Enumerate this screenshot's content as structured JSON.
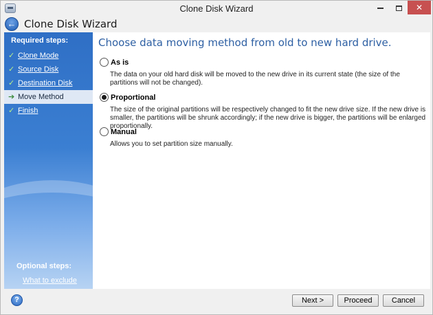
{
  "window": {
    "title": "Clone Disk Wizard"
  },
  "header": {
    "title": "Clone Disk Wizard",
    "back_icon": "back-arrow-icon"
  },
  "sidebar": {
    "required_heading": "Required steps:",
    "steps": [
      {
        "label": "Clone Mode",
        "completed": true,
        "current": false
      },
      {
        "label": "Source Disk",
        "completed": true,
        "current": false
      },
      {
        "label": "Destination Disk",
        "completed": true,
        "current": false
      },
      {
        "label": "Move Method",
        "completed": false,
        "current": true
      },
      {
        "label": "Finish",
        "completed": true,
        "current": false
      }
    ],
    "optional_heading": "Optional steps:",
    "optional_link": "What to exclude"
  },
  "main": {
    "title": "Choose data moving method from old to new hard drive.",
    "options": [
      {
        "label": "As is",
        "selected": false,
        "description": "The data on your old hard disk will be moved to the new drive in its current state (the size of the partitions will not be changed)."
      },
      {
        "label": "Proportional",
        "selected": true,
        "description": "The size of the original partitions will be respectively changed to fit the new drive size. If the new drive is smaller, the partitions will be shrunk accordingly; if the new drive is bigger, the partitions will be enlarged proportionally."
      },
      {
        "label": "Manual",
        "selected": false,
        "description": "Allows you to set partition size manually."
      }
    ]
  },
  "footer": {
    "help_icon": "help-icon",
    "next_label": "Next >",
    "proceed_label": "Proceed",
    "cancel_label": "Cancel"
  },
  "colors": {
    "sidebar_blue": "#3b7fd2",
    "title_blue": "#2d5fa3",
    "close_red": "#c75050"
  }
}
